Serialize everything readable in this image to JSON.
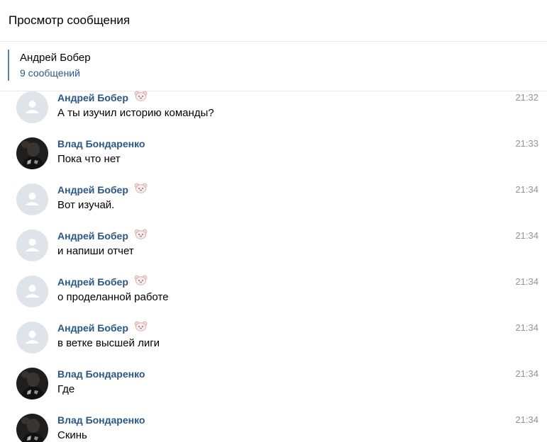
{
  "header": {
    "title": "Просмотр сообщения"
  },
  "conversation": {
    "name": "Андрей Бобер",
    "count_label": "9 сообщений"
  },
  "messages": [
    {
      "author": "Андрей Бобер",
      "text": "А ты изучил историю команды?",
      "time": "21:32",
      "avatar": "default-avatar-icon",
      "badge": "bear-sticker-icon"
    },
    {
      "author": "Влад Бондаренко",
      "text": "Пока что нет",
      "time": "21:33",
      "avatar": "user-photo"
    },
    {
      "author": "Андрей Бобер",
      "text": "Вот изучай.",
      "time": "21:34",
      "avatar": "default-avatar-icon",
      "badge": "bear-sticker-icon"
    },
    {
      "author": "Андрей Бобер",
      "text": "и напиши отчет",
      "time": "21:34",
      "avatar": "default-avatar-icon",
      "badge": "bear-sticker-icon"
    },
    {
      "author": "Андрей Бобер",
      "text": "о проделанной работе",
      "time": "21:34",
      "avatar": "default-avatar-icon",
      "badge": "bear-sticker-icon"
    },
    {
      "author": "Андрей Бобер",
      "text": "в ветке высшей лиги",
      "time": "21:34",
      "avatar": "default-avatar-icon",
      "badge": "bear-sticker-icon"
    },
    {
      "author": "Влад Бондаренко",
      "text": "Где",
      "time": "21:34",
      "avatar": "user-photo"
    },
    {
      "author": "Влад Бондаренко",
      "text": "Скинь",
      "time": "21:34",
      "avatar": "user-photo"
    }
  ],
  "colors": {
    "link": "#2a5885",
    "accent": "#5181b8",
    "time": "#939393",
    "divider": "#e7e8ec"
  }
}
